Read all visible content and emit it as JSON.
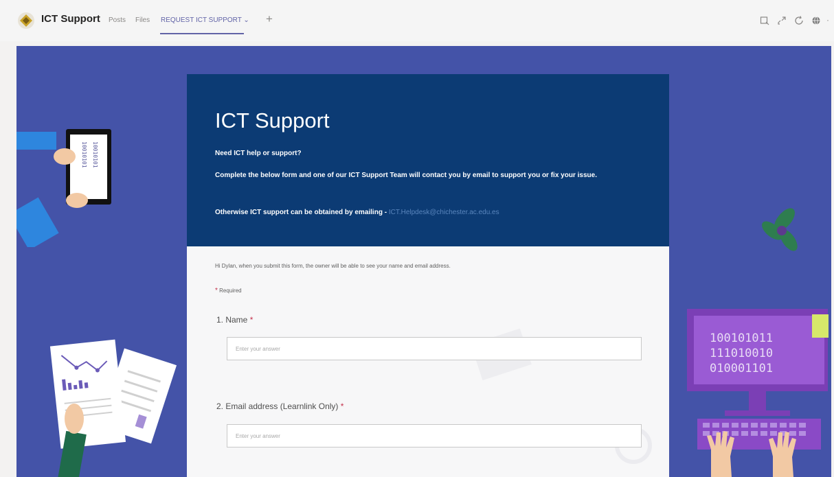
{
  "header": {
    "team_name": "ICT Support",
    "tabs": [
      {
        "label": "Posts"
      },
      {
        "label": "Files"
      },
      {
        "label": "REQUEST ICT SUPPORT ⌄"
      }
    ],
    "add_tab": "+",
    "icons": [
      "expand-icon",
      "popout-icon",
      "refresh-icon",
      "globe-icon"
    ]
  },
  "form": {
    "title": "ICT Support",
    "intro_question": "Need ICT help or support?",
    "intro_text": "Complete the below form and one of our ICT Support Team will contact you by email to support you or fix your issue.",
    "alt_contact_text": "Otherwise ICT support can be obtained by emailing - ",
    "alt_contact_email": "ICT.Helpdesk@chichester.ac.edu.es",
    "notice": "Hi Dylan, when you submit this form, the owner will be able to see your name and email address.",
    "required_star": "*",
    "required_label": "Required",
    "questions": [
      {
        "label": "1. Name",
        "star": "*",
        "placeholder": "Enter your answer"
      },
      {
        "label": "2. Email address (Learnlink Only)",
        "star": "*",
        "placeholder": "Enter your answer"
      }
    ]
  },
  "illustrations": {
    "tablet_text": "10010101",
    "monitor_lines": [
      "100101011",
      "111010010",
      "010001101"
    ]
  },
  "colors": {
    "canvas": "#4453a8",
    "form_header": "#0c3b74",
    "accent": "#6264a7",
    "required": "#c4314b"
  }
}
